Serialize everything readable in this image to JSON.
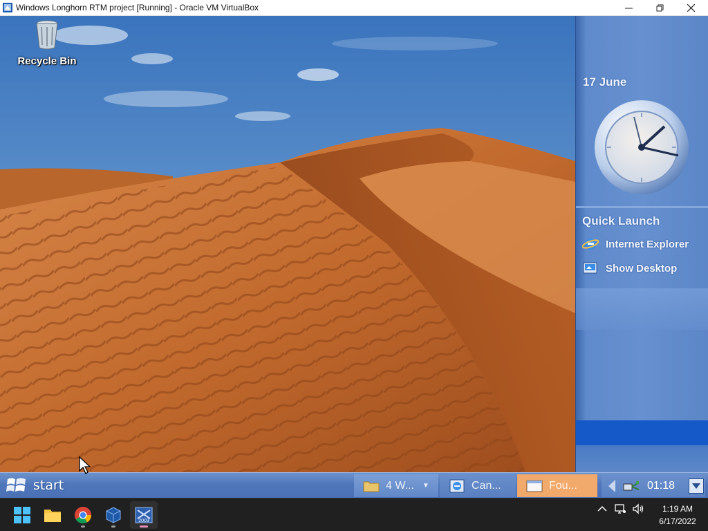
{
  "host_window": {
    "title": "Windows Longhorn RTM project [Running] - Oracle VM VirtualBox",
    "buttons": [
      "minimize",
      "restore",
      "close"
    ]
  },
  "desktop": {
    "icons": [
      {
        "label": "Recycle Bin",
        "icon": "recycle-bin-icon"
      }
    ]
  },
  "sidebar": {
    "date": "17 June",
    "quick_launch": {
      "title": "Quick Launch",
      "items": [
        {
          "label": "Internet Explorer",
          "icon": "internet-explorer-icon"
        },
        {
          "label": "Show Desktop",
          "icon": "show-desktop-icon"
        }
      ]
    }
  },
  "guest_taskbar": {
    "start_label": "start",
    "tasks": [
      {
        "label": "4 W...",
        "icon": "folder-icon",
        "state": "grouped"
      },
      {
        "label": "Can...",
        "icon": "internet-explorer-icon",
        "state": "inactive"
      },
      {
        "label": "Fou...",
        "icon": "window-icon",
        "state": "active"
      }
    ],
    "tray_time": "01:18"
  },
  "host_taskbar": {
    "apps": [
      "windows-start-icon",
      "file-explorer-icon",
      "chrome-icon",
      "virtualbox-icon",
      "longhorn-vm-icon"
    ],
    "active_app_badge": "2003",
    "time": "1:19 AM",
    "date": "6/17/2022"
  },
  "colors": {
    "sidebar": "#6690cf",
    "guest_taskbar": "#5077bb",
    "active_task": "#f2a96c",
    "host_taskbar": "#202020",
    "sand": "#c96d2e",
    "sky": "#4f82c2"
  }
}
